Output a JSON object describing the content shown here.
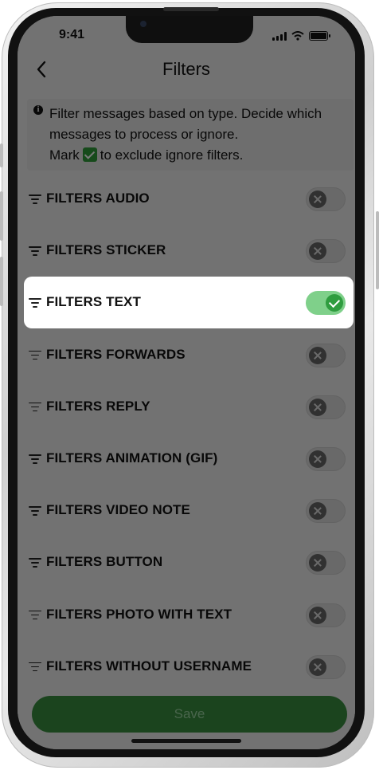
{
  "status_bar": {
    "time": "9:41"
  },
  "header": {
    "title": "Filters"
  },
  "info": {
    "line1": "Filter messages based on type. Decide which",
    "line2": "messages to process or ignore.",
    "line3_prefix": "Mark",
    "line3_suffix": "to exclude ignore filters."
  },
  "filters": [
    {
      "label": "FILTERS AUDIO",
      "enabled": false
    },
    {
      "label": "FILTERS STICKER",
      "enabled": false
    },
    {
      "label": "FILTERS TEXT",
      "enabled": true
    },
    {
      "label": "FILTERS FORWARDS",
      "enabled": false
    },
    {
      "label": "FILTERS REPLY",
      "enabled": false
    },
    {
      "label": "FILTERS ANIMATION (GIF)",
      "enabled": false
    },
    {
      "label": "FILTERS VIDEO NOTE",
      "enabled": false
    },
    {
      "label": "FILTERS BUTTON",
      "enabled": false
    },
    {
      "label": "FILTERS PHOTO WITH TEXT",
      "enabled": false
    },
    {
      "label": "FILTERS WITHOUT USERNAME",
      "enabled": false
    }
  ],
  "footer": {
    "save_label": "Save"
  },
  "colors": {
    "accent": "#2f9d3f",
    "save": "#3a8f40"
  }
}
